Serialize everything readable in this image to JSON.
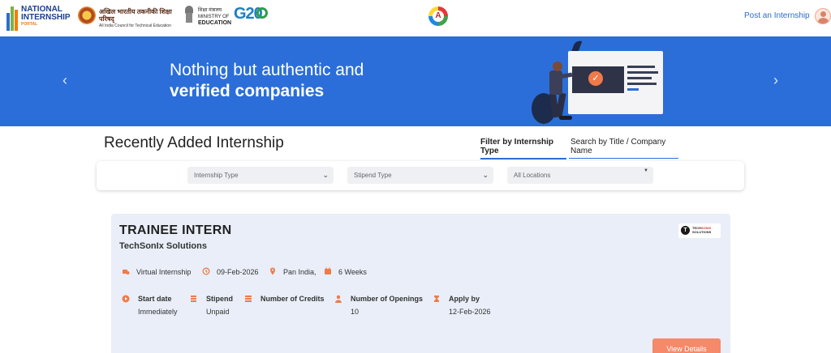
{
  "header": {
    "nip_logo": {
      "line1": "NATIONAL",
      "line2": "INTERNSHIP",
      "line3": "PORTAL"
    },
    "aicte_logo": {
      "hindi": "अखिल भारतीय तकनीकी शिक्षा परिषद्",
      "english": "All India Council for Technical Education"
    },
    "moe_logo": {
      "hindi": "शिक्षा मंत्रालय",
      "line1": "MINISTRY OF",
      "line2": "EDUCATION"
    },
    "g20_logo": {
      "text": "G20"
    },
    "post_internship": "Post an Internship"
  },
  "banner": {
    "line1": "Nothing but authentic and",
    "line2": "verified companies",
    "prev_arrow": "‹",
    "next_arrow": "›",
    "colors": {
      "background": "#2b6ed9",
      "accent": "#f07a4a"
    }
  },
  "section": {
    "title": "Recently Added Internship",
    "filter_tab": "Filter by Internship Type",
    "search_tab": "Search by Title / Company Name"
  },
  "filters": {
    "internship_type": "Internship Type",
    "stipend_type": "Stipend Type",
    "location": "All Locations"
  },
  "card": {
    "title": "TRAINEE INTERN",
    "company": "TechSonIx Solutions",
    "company_logo": {
      "mark": "T",
      "name_a": "TECH",
      "name_b": "SONIX",
      "name_c": "SOLUTIONS"
    },
    "meta": {
      "mode": "Virtual Internship",
      "posted": "09-Feb-2026",
      "location": "Pan India,",
      "duration": "6 Weeks"
    },
    "details": [
      {
        "label": "Start date",
        "value": "Immediately",
        "icon": "play-circle-icon"
      },
      {
        "label": "Stipend",
        "value": "Unpaid",
        "icon": "cash-icon"
      },
      {
        "label": "Number of Credits",
        "value": "",
        "icon": "stack-icon"
      },
      {
        "label": "Number of Openings",
        "value": "10",
        "icon": "person-icon"
      },
      {
        "label": "Apply by",
        "value": "12-Feb-2026",
        "icon": "hourglass-icon"
      }
    ],
    "view_button": "View Details",
    "colors": {
      "card_bg": "#e9eef8",
      "icon": "#f07a4a",
      "button": "#f5896a"
    }
  }
}
